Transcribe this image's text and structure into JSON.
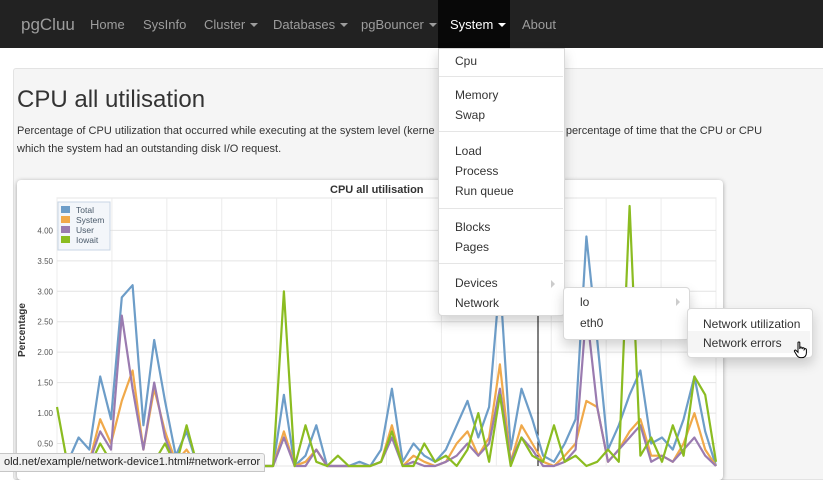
{
  "navbar": {
    "brand": "pgCluu",
    "items": [
      {
        "label": "Home"
      },
      {
        "label": "SysInfo"
      },
      {
        "label": "Cluster"
      },
      {
        "label": "Databases"
      },
      {
        "label": "pgBouncer"
      },
      {
        "label": "System"
      },
      {
        "label": "About"
      }
    ]
  },
  "page": {
    "title": "CPU all utilisation",
    "description_line1": "Percentage of CPU utilization that occurred while executing at the system level (kerne",
    "description_line1_tail": "tion) and the percentage of time that the CPU or CPU",
    "description_line2": "which the system had an outstanding disk I/O request."
  },
  "system_menu": {
    "items": [
      "Cpu",
      "Memory",
      "Swap",
      "Load",
      "Process",
      "Run queue",
      "Blocks",
      "Pages",
      "Devices",
      "Network"
    ]
  },
  "network_menu": {
    "items": [
      "lo",
      "eth0"
    ]
  },
  "lo_menu": {
    "items": [
      "Network utilization",
      "Network errors"
    ]
  },
  "statusbar": {
    "url": "old.net/example/network-device1.html#network-error"
  },
  "chart_data": {
    "type": "line",
    "title": "CPU all utilisation",
    "ylabel": "Percentage",
    "xlabel": "",
    "ylim": [
      0,
      4.4
    ],
    "yticks": [
      "0.50",
      "1.00",
      "1.50",
      "2.00",
      "2.50",
      "3.00",
      "3.50",
      "4.00"
    ],
    "legend_position": "top-left",
    "grid": true,
    "series": [
      {
        "name": "Total",
        "color": "#6d9dc8",
        "values": [
          0.1,
          0.2,
          0.6,
          0.4,
          1.6,
          0.9,
          2.9,
          3.1,
          0.8,
          2.2,
          1.2,
          0.3,
          0.7,
          0.1,
          0.1,
          0.2,
          0.1,
          0.1,
          0.2,
          0.1,
          0.1,
          1.3,
          0.1,
          0.3,
          0.8,
          0.1,
          0.1,
          0.1,
          0.2,
          0.1,
          0.4,
          1.4,
          0.2,
          0.5,
          0.3,
          0.2,
          0.4,
          0.8,
          1.2,
          0.6,
          1.1,
          3.2,
          0.4,
          1.4,
          0.9,
          0.3,
          0.2,
          0.5,
          0.9,
          3.9,
          2.2,
          0.4,
          0.8,
          1.3,
          1.7,
          0.5,
          0.6,
          0.4,
          0.9,
          1.6,
          0.7,
          0.1
        ]
      },
      {
        "name": "System",
        "color": "#f0a94a",
        "values": [
          0.05,
          0.1,
          0.3,
          0.2,
          0.9,
          0.5,
          1.2,
          1.7,
          0.4,
          1.4,
          0.7,
          0.2,
          0.4,
          0.1,
          0.05,
          0.1,
          0.05,
          0.05,
          0.1,
          0.05,
          0.05,
          0.7,
          0.05,
          0.2,
          0.4,
          0.05,
          0.05,
          0.05,
          0.1,
          0.05,
          0.2,
          0.8,
          0.1,
          0.3,
          0.2,
          0.1,
          0.2,
          0.5,
          0.7,
          0.3,
          0.6,
          1.8,
          0.2,
          0.8,
          0.5,
          0.2,
          0.1,
          0.3,
          0.5,
          1.2,
          1.1,
          0.2,
          0.4,
          0.7,
          0.9,
          0.3,
          0.3,
          0.2,
          0.5,
          1.0,
          0.4,
          0.05
        ]
      },
      {
        "name": "User",
        "color": "#9a7bb0",
        "values": [
          0.05,
          0.1,
          0.3,
          0.2,
          0.7,
          0.4,
          2.6,
          1.4,
          0.4,
          1.5,
          0.6,
          0.1,
          0.3,
          0.05,
          0.05,
          0.1,
          0.05,
          0.05,
          0.1,
          0.05,
          0.05,
          0.6,
          0.05,
          0.1,
          0.4,
          0.05,
          0.05,
          0.05,
          0.1,
          0.05,
          0.2,
          0.6,
          0.1,
          0.2,
          0.1,
          0.1,
          0.2,
          0.3,
          0.5,
          0.3,
          0.5,
          1.4,
          0.2,
          0.6,
          0.4,
          0.1,
          0.1,
          0.2,
          0.4,
          2.7,
          1.1,
          0.2,
          0.4,
          0.6,
          0.8,
          0.2,
          0.3,
          0.2,
          0.4,
          0.6,
          0.3,
          0.05
        ]
      },
      {
        "name": "Iowait",
        "color": "#8bbc21",
        "values": [
          1.1,
          0.1,
          0.2,
          0.1,
          0.5,
          0.2,
          0.1,
          0.3,
          0.1,
          0.2,
          0.5,
          0.1,
          0.8,
          0.1,
          0.2,
          0.1,
          0.1,
          0.3,
          0.1,
          0.1,
          0.1,
          3.0,
          0.1,
          0.8,
          0.2,
          0.1,
          0.3,
          0.1,
          0.1,
          0.1,
          0.2,
          0.7,
          0.1,
          0.1,
          0.5,
          0.2,
          0.3,
          0.1,
          0.4,
          1.0,
          0.2,
          1.3,
          0.1,
          0.6,
          0.3,
          0.2,
          0.8,
          0.2,
          0.3,
          0.1,
          0.2,
          0.4,
          0.2,
          4.4,
          0.3,
          0.6,
          0.2,
          0.8,
          0.3,
          1.6,
          1.3,
          0.2
        ]
      }
    ]
  }
}
